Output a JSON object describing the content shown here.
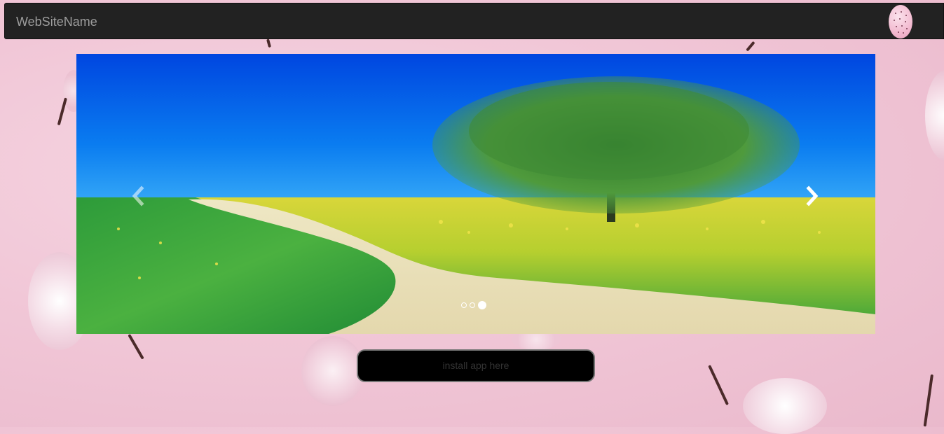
{
  "navbar": {
    "brand": "WebSiteName",
    "avatar_icon": "avatar"
  },
  "carousel": {
    "prev_icon": "chevron-left-icon",
    "next_icon": "chevron-right-icon",
    "slide_count": 3,
    "active_slide": 3,
    "slide_description_icon": "landscape-tree-road-image"
  },
  "install": {
    "label": "install app here"
  },
  "colors": {
    "navbar": "#222222",
    "brand_text": "#9d9d9d",
    "background": "#f1c7d7",
    "button": "#000000"
  }
}
